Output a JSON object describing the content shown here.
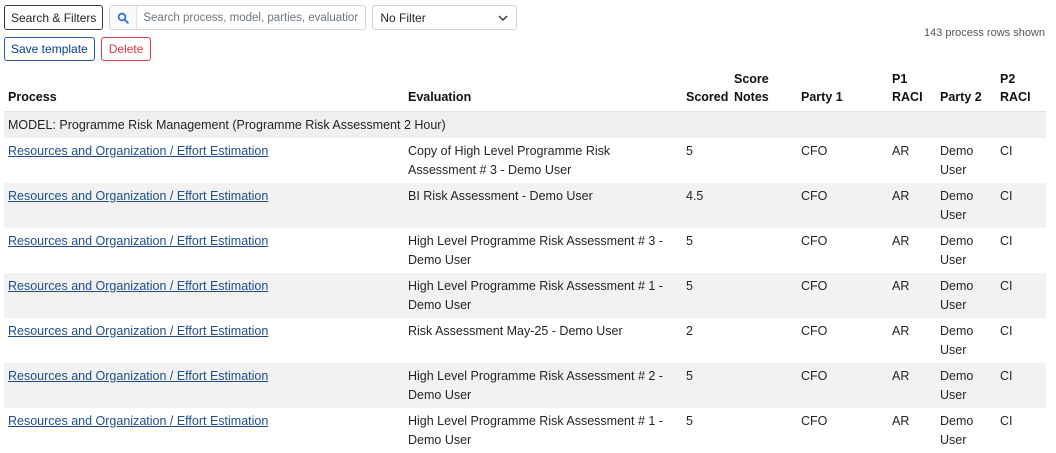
{
  "toolbar": {
    "filters_label": "Search & Filters",
    "search_placeholder": "Search process, model, parties, evaluatior",
    "filter_selected": "No Filter",
    "save_template_label": "Save template",
    "delete_label": "Delete"
  },
  "row_count": "143 process rows shown",
  "table": {
    "headers": {
      "process": "Process",
      "evaluation": "Evaluation",
      "scored": "Scored",
      "score_notes": "Score Notes",
      "party1": "Party 1",
      "p1_raci": "P1 RACI",
      "party2": "Party 2",
      "p2_raci": "P2 RACI"
    },
    "group_label": "MODEL: Programme Risk Management (Programme Risk Assessment 2 Hour)",
    "rows": [
      {
        "process": "Resources and Organization / Effort Estimation",
        "evaluation": "Copy of High Level Programme Risk Assessment # 3 - Demo User",
        "scored": "5",
        "notes": "",
        "party1": "CFO",
        "p1_raci": "AR",
        "party2": "Demo User",
        "p2_raci": "CI"
      },
      {
        "process": "Resources and Organization / Effort Estimation",
        "evaluation": "BI Risk Assessment - Demo User",
        "scored": "4.5",
        "notes": "",
        "party1": "CFO",
        "p1_raci": "AR",
        "party2": "Demo User",
        "p2_raci": "CI"
      },
      {
        "process": "Resources and Organization / Effort Estimation",
        "evaluation": "High Level Programme Risk Assessment # 3 - Demo User",
        "scored": "5",
        "notes": "",
        "party1": "CFO",
        "p1_raci": "AR",
        "party2": "Demo User",
        "p2_raci": "CI"
      },
      {
        "process": "Resources and Organization / Effort Estimation",
        "evaluation": "High Level Programme Risk Assessment # 1 - Demo User",
        "scored": "5",
        "notes": "",
        "party1": "CFO",
        "p1_raci": "AR",
        "party2": "Demo User",
        "p2_raci": "CI"
      },
      {
        "process": "Resources and Organization / Effort Estimation",
        "evaluation": "Risk Assessment May-25 - Demo User",
        "scored": "2",
        "notes": "",
        "party1": "CFO",
        "p1_raci": "AR",
        "party2": "Demo User",
        "p2_raci": "CI"
      },
      {
        "process": "Resources and Organization / Effort Estimation",
        "evaluation": "High Level Programme Risk Assessment # 2 - Demo User",
        "scored": "5",
        "notes": "",
        "party1": "CFO",
        "p1_raci": "AR",
        "party2": "Demo User",
        "p2_raci": "CI"
      },
      {
        "process": "Resources and Organization / Effort Estimation",
        "evaluation": "High Level Programme Risk Assessment # 1 - Demo User",
        "scored": "5",
        "notes": "",
        "party1": "CFO",
        "p1_raci": "AR",
        "party2": "Demo User",
        "p2_raci": "CI"
      }
    ]
  },
  "icons": {
    "search": "search-icon",
    "dropdown": "chevron-down-icon"
  },
  "colors": {
    "link": "#1f4f8a",
    "delete": "#dc3545",
    "save": "#2b5aa8",
    "stripe": "#f2f2f2"
  }
}
